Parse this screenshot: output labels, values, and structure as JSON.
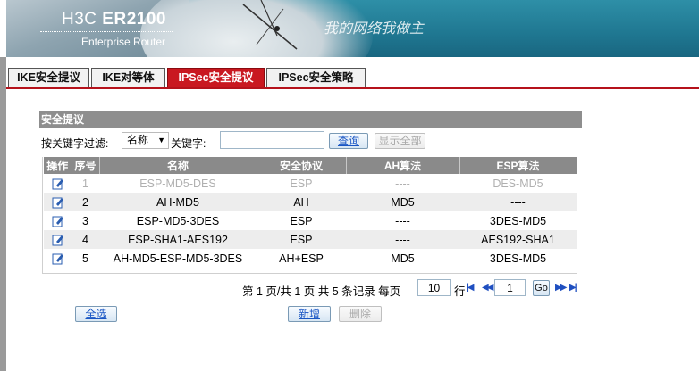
{
  "brand": {
    "product_prefix": "H3C",
    "product_model": "ER2100",
    "subtitle": "Enterprise Router",
    "slogan": "我的网络我做主"
  },
  "tabs": [
    {
      "label": "IKE安全提议",
      "active": false
    },
    {
      "label": "IKE对等体",
      "active": false
    },
    {
      "label": "IPSec安全提议",
      "active": true
    },
    {
      "label": "IPSec安全策略",
      "active": false
    }
  ],
  "section": {
    "title": "安全提议"
  },
  "filter": {
    "label": "按关键字过滤:",
    "field_selected": "名称",
    "keyword_label": "关键字:",
    "keyword_value": "",
    "query_button": "查询",
    "show_all_button": "显示全部"
  },
  "table": {
    "headers": [
      "操作",
      "序号",
      "名称",
      "安全协议",
      "AH算法",
      "ESP算法"
    ],
    "rows": [
      {
        "no": "1",
        "name": "ESP-MD5-DES",
        "protocol": "ESP",
        "ah": "----",
        "esp": "DES-MD5",
        "dim": true
      },
      {
        "no": "2",
        "name": "AH-MD5",
        "protocol": "AH",
        "ah": "MD5",
        "esp": "----",
        "dim": false
      },
      {
        "no": "3",
        "name": "ESP-MD5-3DES",
        "protocol": "ESP",
        "ah": "----",
        "esp": "3DES-MD5",
        "dim": false
      },
      {
        "no": "4",
        "name": "ESP-SHA1-AES192",
        "protocol": "ESP",
        "ah": "----",
        "esp": "AES192-SHA1",
        "dim": false
      },
      {
        "no": "5",
        "name": "AH-MD5-ESP-MD5-3DES",
        "protocol": "AH+ESP",
        "ah": "MD5",
        "esp": "3DES-MD5",
        "dim": false
      }
    ]
  },
  "pager": {
    "summary": "第 1 页/共 1 页 共 5 条记录 每页",
    "per_page": "10",
    "rows_suffix": "行",
    "current_page": "1",
    "go_button": "Go"
  },
  "actions": {
    "select_all": "全选",
    "add": "新增",
    "delete": "删除"
  },
  "colors": {
    "active_tab": "#c91820",
    "header_gray": "#8a8a8a",
    "link_blue": "#1a56c4"
  }
}
